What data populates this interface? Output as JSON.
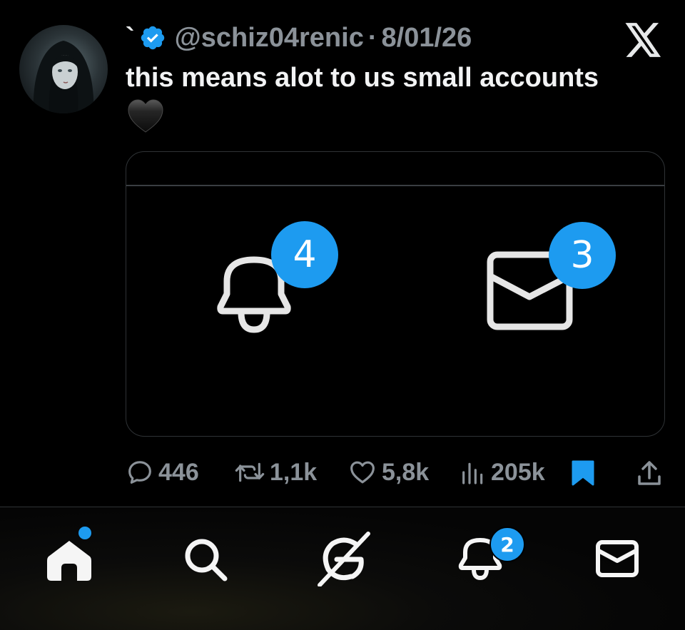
{
  "tweet": {
    "display_name": "`",
    "verified": true,
    "handle": "@schiz04renic",
    "separator": "·",
    "date": "8/01/26",
    "text": "this means alot to us small accounts",
    "emoji": "black-heart",
    "media": {
      "notifications_badge": "4",
      "messages_badge": "3"
    }
  },
  "actions": {
    "replies": "446",
    "retweets": "1,1k",
    "likes": "5,8k",
    "views": "205k",
    "bookmarked": true
  },
  "bottom_nav": {
    "items": [
      "home-icon",
      "search-icon",
      "grok-icon",
      "bell-icon",
      "mail-icon"
    ],
    "home_has_new": true,
    "notifications_badge": "2"
  },
  "colors": {
    "background": "#000000",
    "accent": "#1d9bf0",
    "text": "#e7e9ea",
    "muted": "#8b9299"
  }
}
